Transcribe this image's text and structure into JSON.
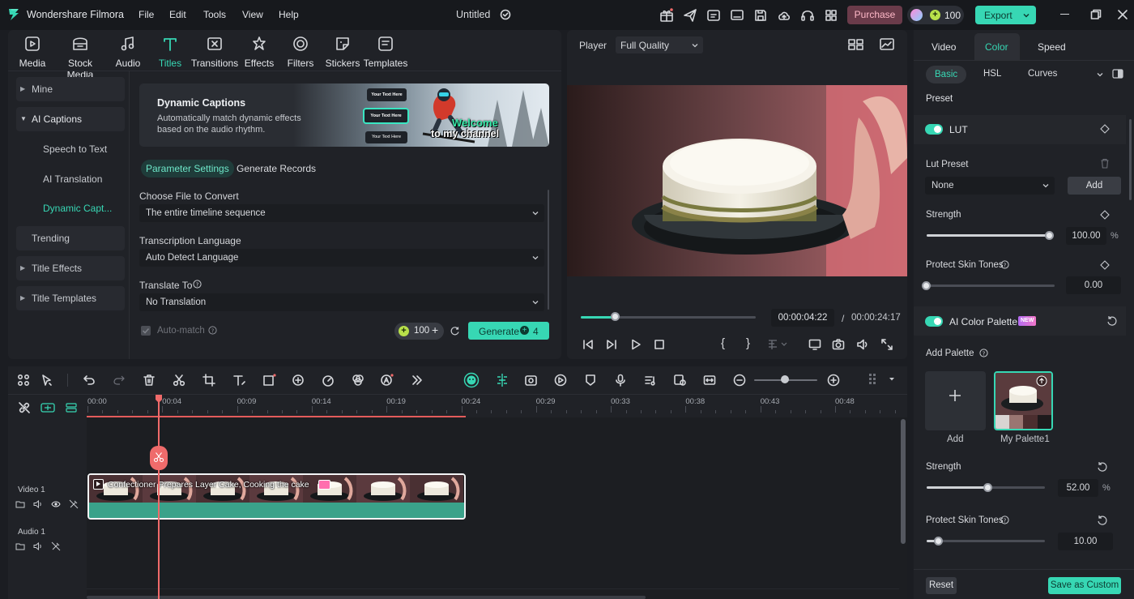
{
  "app": {
    "name": "Wondershare Filmora",
    "project": "Untitled"
  },
  "menu": [
    "File",
    "Edit",
    "Tools",
    "View",
    "Help"
  ],
  "topbar": {
    "purchase": "Purchase",
    "credits": "100",
    "export": "Export"
  },
  "media_tabs": [
    "Media",
    "Stock Media",
    "Audio",
    "Titles",
    "Transitions",
    "Effects",
    "Filters",
    "Stickers",
    "Templates"
  ],
  "sidebar": {
    "mine": "Mine",
    "ai_captions": "AI Captions",
    "speech_to_text": "Speech to Text",
    "ai_translation": "AI Translation",
    "dynamic_captions": "Dynamic Capt...",
    "trending": "Trending",
    "title_effects": "Title Effects",
    "title_templates": "Title Templates"
  },
  "banner": {
    "title": "Dynamic Captions",
    "desc": "Automatically match dynamic effects based on the audio rhythm.",
    "caption_1": "Your Text Here",
    "caption_2": "Your Text Here",
    "caption_3": "Your Text Here",
    "welcome_1": "Welcome",
    "welcome_2": "to my channel"
  },
  "subtabs": {
    "param": "Parameter Settings",
    "records": "Generate Records"
  },
  "form": {
    "file_label": "Choose File to Convert",
    "file_value": "The entire timeline sequence",
    "lang_label": "Transcription Language",
    "lang_value": "Auto Detect Language",
    "translate_label": "Translate To",
    "translate_value": "No Translation",
    "automatch": "Auto-match",
    "credits": "100",
    "generate": "Generate",
    "generate_cost": "4"
  },
  "player": {
    "label": "Player",
    "quality": "Full Quality",
    "current": "00:00:04:22",
    "separator": "/",
    "total": "00:00:24:17",
    "progress": 0.2
  },
  "props": {
    "tabs": [
      "Video",
      "Color",
      "Speed"
    ],
    "subtabs": [
      "Basic",
      "HSL",
      "Curves"
    ],
    "preset": "Preset",
    "lut": "LUT",
    "lut_preset": "Lut Preset",
    "lut_value": "None",
    "add": "Add",
    "strength": "Strength",
    "strength_value": "100.00",
    "strength_unit": "%",
    "strength_level": 1.0,
    "protect": "Protect Skin Tones",
    "protect_value": "0.00",
    "protect_level": 0.0,
    "ai_palette": "AI Color Palette",
    "new_badge": "NEW",
    "add_palette": "Add Palette",
    "palette_add": "Add",
    "palette_name": "My Palette1",
    "strength2": "Strength",
    "strength2_value": "52.00",
    "strength2_unit": "%",
    "strength2_level": 0.52,
    "protect2": "Protect Skin Tones",
    "protect2_value": "10.00",
    "protect2_level": 0.1,
    "reset": "Reset",
    "save_custom": "Save as Custom"
  },
  "timeline": {
    "ticks": [
      "00:00",
      "00:04",
      "00:09",
      "00:14",
      "00:19",
      "00:24",
      "00:29",
      "00:33",
      "00:38",
      "00:43",
      "00:48"
    ],
    "video_track": "Video 1",
    "audio_track": "Audio 1",
    "clip_title": "Confectioner Prepares Layer Cake, Cooking the cake"
  },
  "colors": {
    "accent": "#37d7b4",
    "playhead": "#f06a6a",
    "purchase": "#6a3b4a"
  }
}
